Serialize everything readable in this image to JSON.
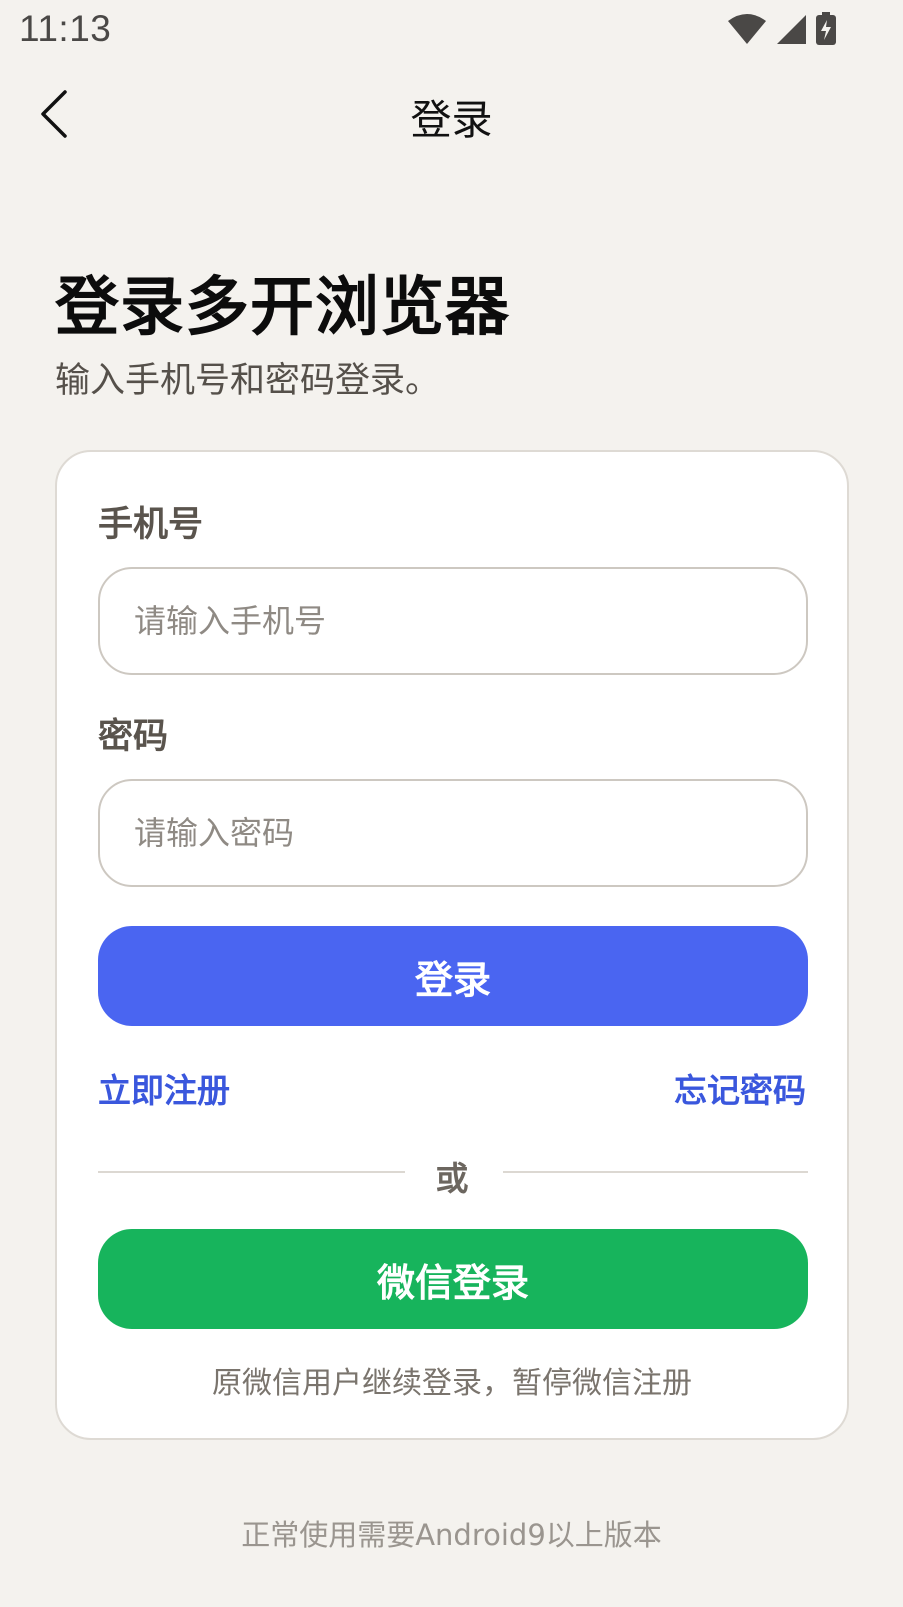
{
  "status_bar": {
    "time": "11:13",
    "icons": [
      "wifi-icon",
      "signal-icon",
      "battery-charging-icon"
    ]
  },
  "app_bar": {
    "back_icon": "chevron-left-icon",
    "title": "登录"
  },
  "headline": {
    "title": "登录多开浏览器",
    "subtitle": "输入手机号和密码登录。"
  },
  "form": {
    "phone_label": "手机号",
    "phone_placeholder": "请输入手机号",
    "phone_value": "",
    "password_label": "密码",
    "password_placeholder": "请输入密码",
    "password_value": "",
    "login_button": "登录",
    "register_link": "立即注册",
    "forgot_link": "忘记密码",
    "divider_text": "或",
    "wechat_button": "微信登录",
    "wechat_note": "原微信用户继续登录，暂停微信注册"
  },
  "footer": {
    "note": "正常使用需要Android9以上版本"
  },
  "colors": {
    "background": "#f4f2ee",
    "primary": "#4a65f1",
    "link": "#3a57dd",
    "wechat": "#17b45c"
  }
}
